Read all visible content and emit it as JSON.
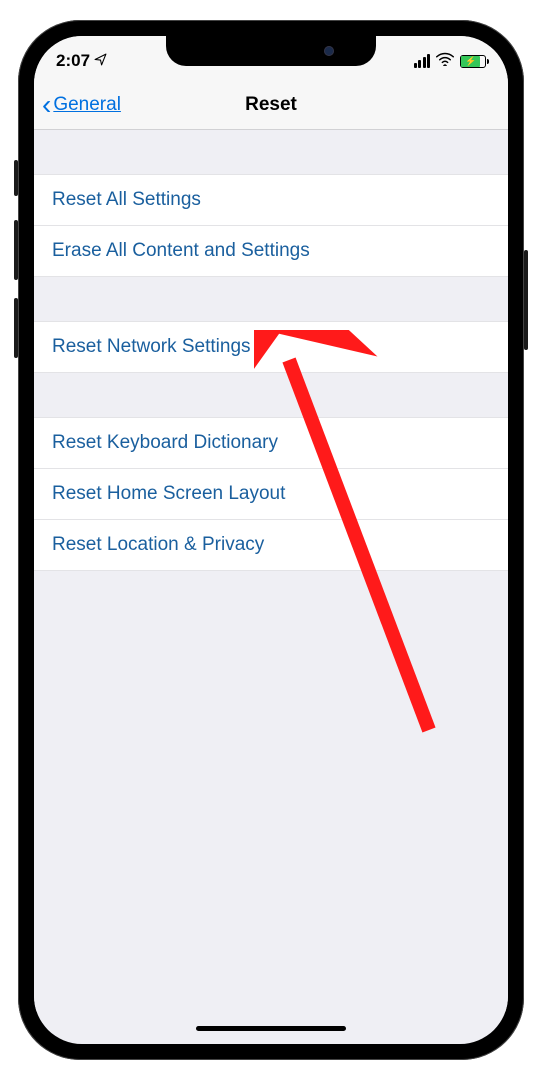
{
  "status_bar": {
    "time": "2:07",
    "location_icon": "location-arrow",
    "signal_bars": 4,
    "wifi_icon": "wifi",
    "battery_charging": true
  },
  "nav": {
    "back_label": "General",
    "title": "Reset"
  },
  "groups": [
    {
      "items": [
        {
          "label": "Reset All Settings"
        },
        {
          "label": "Erase All Content and Settings"
        }
      ]
    },
    {
      "items": [
        {
          "label": "Reset Network Settings"
        }
      ]
    },
    {
      "items": [
        {
          "label": "Reset Keyboard Dictionary"
        },
        {
          "label": "Reset Home Screen Layout"
        },
        {
          "label": "Reset Location & Privacy"
        }
      ]
    }
  ],
  "annotation": {
    "type": "arrow",
    "color": "#ff1a1a",
    "target_row_label": "Reset Network Settings"
  }
}
